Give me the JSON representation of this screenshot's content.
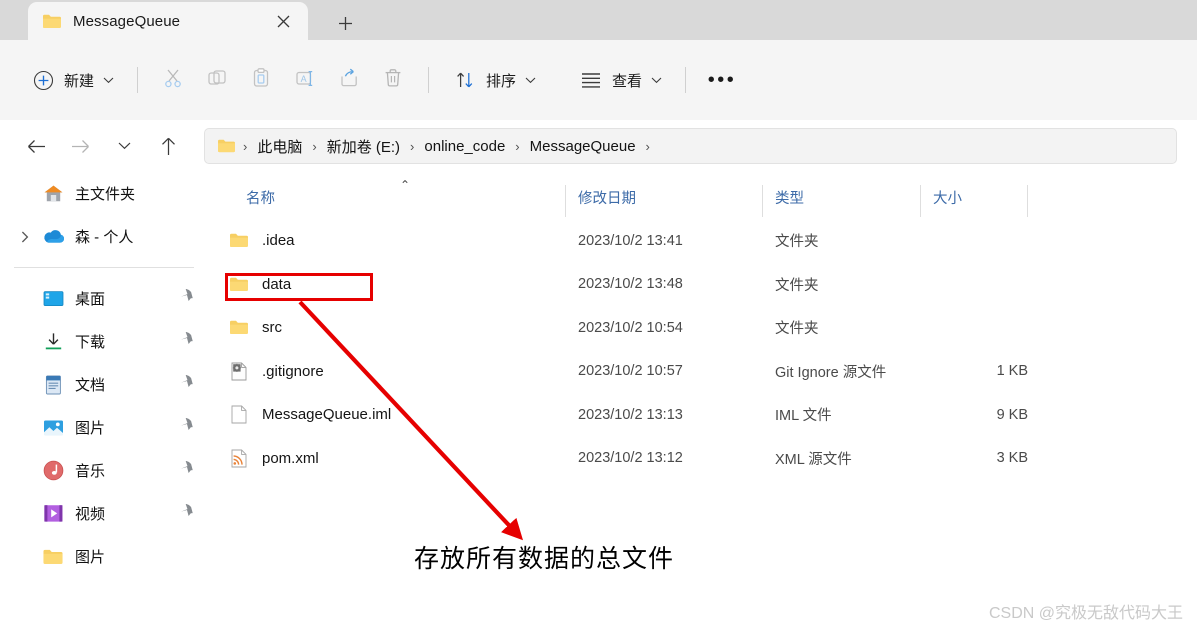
{
  "window": {
    "tab": {
      "title": "MessageQueue",
      "icon": "folder-icon",
      "close_icon": "✕"
    },
    "new_tab_icon": "+"
  },
  "toolbar": {
    "new_label": "新建",
    "new_icon": "plus-circle-icon",
    "caret": "⌄",
    "cut_icon": "scissors-icon",
    "copy_icon": "copy-icon",
    "paste_icon": "paste-icon",
    "rename_icon": "rename-icon",
    "share_icon": "share-icon",
    "delete_icon": "trash-icon",
    "sort_label": "排序",
    "sort_icon": "sort-arrows-icon",
    "view_label": "查看",
    "view_icon": "list-lines-icon",
    "more_icon": "•••"
  },
  "nav": {
    "back_icon": "←",
    "forward_icon": "→",
    "recent_icon": "⌄",
    "up_icon": "↑",
    "breadcrumb": {
      "root_icon": "folder-icon",
      "separator": "›",
      "items": [
        "此电脑",
        "新加卷 (E:)",
        "online_code",
        "MessageQueue"
      ]
    }
  },
  "sidebar": {
    "items": [
      {
        "label": "主文件夹",
        "icon": "home-icon",
        "expandable": false,
        "pinned": false
      },
      {
        "label": "森 - 个人",
        "icon": "onedrive-cloud-icon",
        "expandable": true,
        "pinned": false
      }
    ],
    "quick_items": [
      {
        "label": "桌面",
        "icon": "desktop-icon",
        "pinned": true
      },
      {
        "label": "下载",
        "icon": "download-icon",
        "pinned": true
      },
      {
        "label": "文档",
        "icon": "document-icon",
        "pinned": true
      },
      {
        "label": "图片",
        "icon": "pictures-icon",
        "pinned": true
      },
      {
        "label": "音乐",
        "icon": "music-icon",
        "pinned": true
      },
      {
        "label": "视频",
        "icon": "video-icon",
        "pinned": true
      },
      {
        "label": "图片",
        "icon": "folder-icon",
        "pinned": false
      }
    ],
    "pin_icon": "pin-icon",
    "chevron_icon": "›"
  },
  "filelist": {
    "columns": [
      {
        "key": "name",
        "label": "名称"
      },
      {
        "key": "date",
        "label": "修改日期"
      },
      {
        "key": "type",
        "label": "类型"
      },
      {
        "key": "size",
        "label": "大小"
      }
    ],
    "sort_indicator": "⌃",
    "rows": [
      {
        "icon": "folder-icon",
        "name": ".idea",
        "date": "2023/10/2 13:41",
        "type": "文件夹",
        "size": ""
      },
      {
        "icon": "folder-icon",
        "name": "data",
        "date": "2023/10/2 13:48",
        "type": "文件夹",
        "size": ""
      },
      {
        "icon": "folder-icon",
        "name": "src",
        "date": "2023/10/2 10:54",
        "type": "文件夹",
        "size": ""
      },
      {
        "icon": "gitignore-icon",
        "name": ".gitignore",
        "date": "2023/10/2 10:57",
        "type": "Git Ignore 源文件",
        "size": "1 KB"
      },
      {
        "icon": "file-icon",
        "name": "MessageQueue.iml",
        "date": "2023/10/2 13:13",
        "type": "IML 文件",
        "size": "9 KB"
      },
      {
        "icon": "xml-icon",
        "name": "pom.xml",
        "date": "2023/10/2 13:12",
        "type": "XML 源文件",
        "size": "3 KB"
      }
    ]
  },
  "annotations": {
    "highlight_target": "data",
    "highlight_color": "#e60000",
    "arrow_color": "#e60000",
    "caption": "存放所有数据的总文件"
  },
  "watermark": {
    "text": "CSDN @究极无敌代码大王"
  }
}
